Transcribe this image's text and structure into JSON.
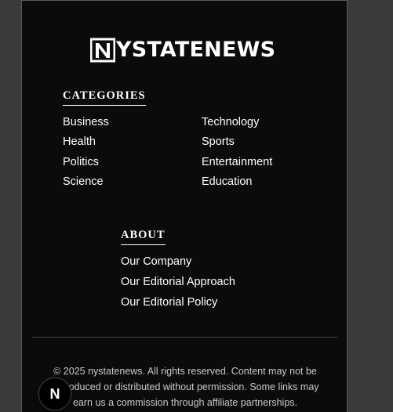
{
  "logo": {
    "text": "YSTATENEWS",
    "mark_letter": "N",
    "icon": "logo-n-icon"
  },
  "categories": {
    "heading": "CATEGORIES",
    "left": [
      "Business",
      "Health",
      "Politics",
      "Science"
    ],
    "right": [
      "Technology",
      "Sports",
      "Entertainment",
      "Education"
    ]
  },
  "about": {
    "heading": "ABOUT",
    "links": [
      "Our Company",
      "Our Editorial Approach",
      "Our Editorial Policy"
    ]
  },
  "footer": {
    "copyright": "© 2025 nystatenews. All rights reserved. Content may not be reproduced or distributed without permission. Some links may earn us a commission through affiliate partnerships."
  },
  "dev_badge": {
    "label": "N",
    "icon": "nextjs-icon"
  },
  "colors": {
    "background": "#0b0b0b",
    "text": "#ffffff",
    "muted_text": "#c9c9c9",
    "outer_background": "#3a3a3a"
  }
}
